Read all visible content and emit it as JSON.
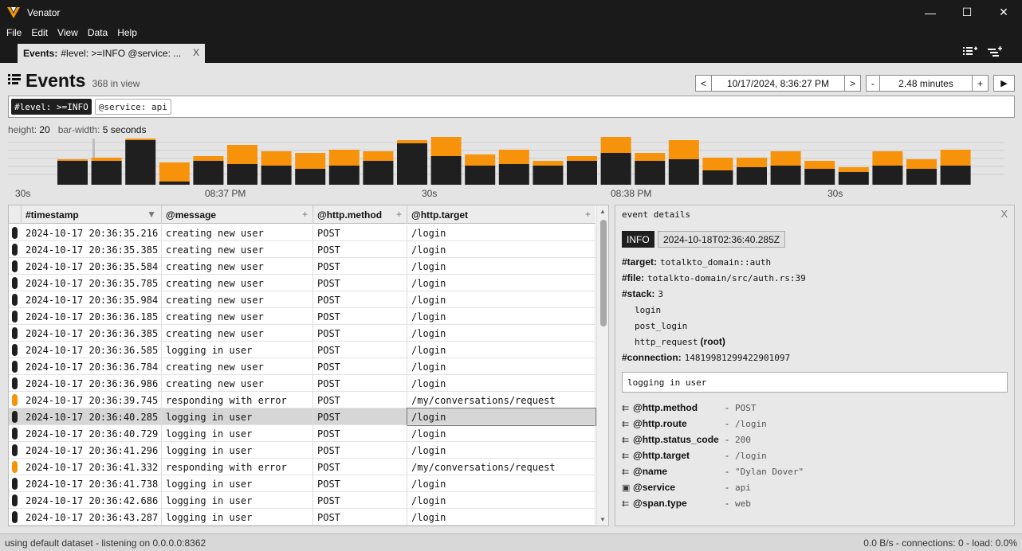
{
  "window": {
    "title": "Venator",
    "minimize": "—",
    "maximize": "☐",
    "close": "✕"
  },
  "menu": [
    "File",
    "Edit",
    "View",
    "Data",
    "Help"
  ],
  "tab": {
    "label_bold": "Events:",
    "label": "#level: >=INFO @service: ...",
    "close": "X"
  },
  "header": {
    "title": "Events",
    "in_view": "368 in view",
    "prev": "<",
    "datetime": "10/17/2024, 8:36:27 PM",
    "next": ">",
    "minus": "-",
    "duration": "2.48 minutes",
    "plus": "+",
    "play": "▶"
  },
  "filter": {
    "chips": [
      "#level: >=INFO",
      "@service: api"
    ]
  },
  "histogram_info": {
    "height_label": "height:",
    "height_value": "20",
    "bar_width_label": "bar-width:",
    "bar_width_value": "5 seconds"
  },
  "chart_data": {
    "type": "bar",
    "ticks": [
      "30s",
      "08:37 PM",
      "30s",
      "08:38 PM",
      "30s"
    ],
    "colors": {
      "info": "#1f1f1f",
      "warn": "#f7930a"
    },
    "series": [
      {
        "values": [
          15,
          15,
          28,
          2,
          15,
          13,
          12,
          10,
          12,
          15,
          26,
          18,
          12,
          13,
          12,
          15,
          20,
          15,
          16,
          9,
          11,
          12,
          10,
          8,
          12,
          10,
          12
        ]
      },
      {
        "values": [
          1,
          2,
          1,
          12,
          3,
          12,
          9,
          10,
          10,
          6,
          2,
          12,
          7,
          9,
          3,
          3,
          10,
          5,
          12,
          8,
          6,
          9,
          5,
          3,
          9,
          6,
          10
        ]
      }
    ]
  },
  "table": {
    "columns": [
      "#timestamp",
      "@message",
      "@http.method",
      "@http.target"
    ],
    "sort_icon": "▼",
    "plus": "+",
    "rows": [
      {
        "level": "info",
        "timestamp": "2024-10-17 20:36:35.216",
        "message": "creating new user",
        "method": "POST",
        "target": "/login"
      },
      {
        "level": "info",
        "timestamp": "2024-10-17 20:36:35.385",
        "message": "creating new user",
        "method": "POST",
        "target": "/login"
      },
      {
        "level": "info",
        "timestamp": "2024-10-17 20:36:35.584",
        "message": "creating new user",
        "method": "POST",
        "target": "/login"
      },
      {
        "level": "info",
        "timestamp": "2024-10-17 20:36:35.785",
        "message": "creating new user",
        "method": "POST",
        "target": "/login"
      },
      {
        "level": "info",
        "timestamp": "2024-10-17 20:36:35.984",
        "message": "creating new user",
        "method": "POST",
        "target": "/login"
      },
      {
        "level": "info",
        "timestamp": "2024-10-17 20:36:36.185",
        "message": "creating new user",
        "method": "POST",
        "target": "/login"
      },
      {
        "level": "info",
        "timestamp": "2024-10-17 20:36:36.385",
        "message": "creating new user",
        "method": "POST",
        "target": "/login"
      },
      {
        "level": "info",
        "timestamp": "2024-10-17 20:36:36.585",
        "message": "logging in user",
        "method": "POST",
        "target": "/login"
      },
      {
        "level": "info",
        "timestamp": "2024-10-17 20:36:36.784",
        "message": "creating new user",
        "method": "POST",
        "target": "/login"
      },
      {
        "level": "info",
        "timestamp": "2024-10-17 20:36:36.986",
        "message": "creating new user",
        "method": "POST",
        "target": "/login"
      },
      {
        "level": "warn",
        "timestamp": "2024-10-17 20:36:39.745",
        "message": "responding with error",
        "method": "POST",
        "target": "/my/conversations/request"
      },
      {
        "level": "info",
        "timestamp": "2024-10-17 20:36:40.285",
        "message": "logging in user",
        "method": "POST",
        "target": "/login",
        "selected": true
      },
      {
        "level": "info",
        "timestamp": "2024-10-17 20:36:40.729",
        "message": "logging in user",
        "method": "POST",
        "target": "/login"
      },
      {
        "level": "info",
        "timestamp": "2024-10-17 20:36:41.296",
        "message": "logging in user",
        "method": "POST",
        "target": "/login"
      },
      {
        "level": "warn",
        "timestamp": "2024-10-17 20:36:41.332",
        "message": "responding with error",
        "method": "POST",
        "target": "/my/conversations/request"
      },
      {
        "level": "info",
        "timestamp": "2024-10-17 20:36:41.738",
        "message": "logging in user",
        "method": "POST",
        "target": "/login"
      },
      {
        "level": "info",
        "timestamp": "2024-10-17 20:36:42.686",
        "message": "logging in user",
        "method": "POST",
        "target": "/login"
      },
      {
        "level": "info",
        "timestamp": "2024-10-17 20:36:43.287",
        "message": "logging in user",
        "method": "POST",
        "target": "/login"
      }
    ]
  },
  "details": {
    "title": "event details",
    "close": "X",
    "level": "INFO",
    "timestamp": "2024-10-18T02:36:40.285Z",
    "target_key": "#target:",
    "target_val": "totalkto_domain::auth",
    "file_key": "#file:",
    "file_val": "totalkto-domain/src/auth.rs:39",
    "stack_key": "#stack:",
    "stack_val": "3",
    "stack": [
      "login",
      "post_login",
      "http_request"
    ],
    "root_label": "(root)",
    "connection_key": "#connection:",
    "connection_val": "14819981299422901097",
    "message": "logging in user",
    "attributes": [
      {
        "icon": "⇇",
        "key": "@http.method",
        "value": "POST"
      },
      {
        "icon": "⇇",
        "key": "@http.route",
        "value": "/login"
      },
      {
        "icon": "⇇",
        "key": "@http.status_code",
        "value": "200"
      },
      {
        "icon": "⇇",
        "key": "@http.target",
        "value": "/login"
      },
      {
        "icon": "⇇",
        "key": "@name",
        "value": "\"Dylan Dover\""
      },
      {
        "icon": "▣",
        "key": "@service",
        "value": "api"
      },
      {
        "icon": "⇇",
        "key": "@span.type",
        "value": "web"
      }
    ],
    "dash": "-"
  },
  "status": {
    "left": "using default dataset - listening on 0.0.0.0:8362",
    "right": "0.0 B/s - connections: 0 - load: 0.0%"
  }
}
